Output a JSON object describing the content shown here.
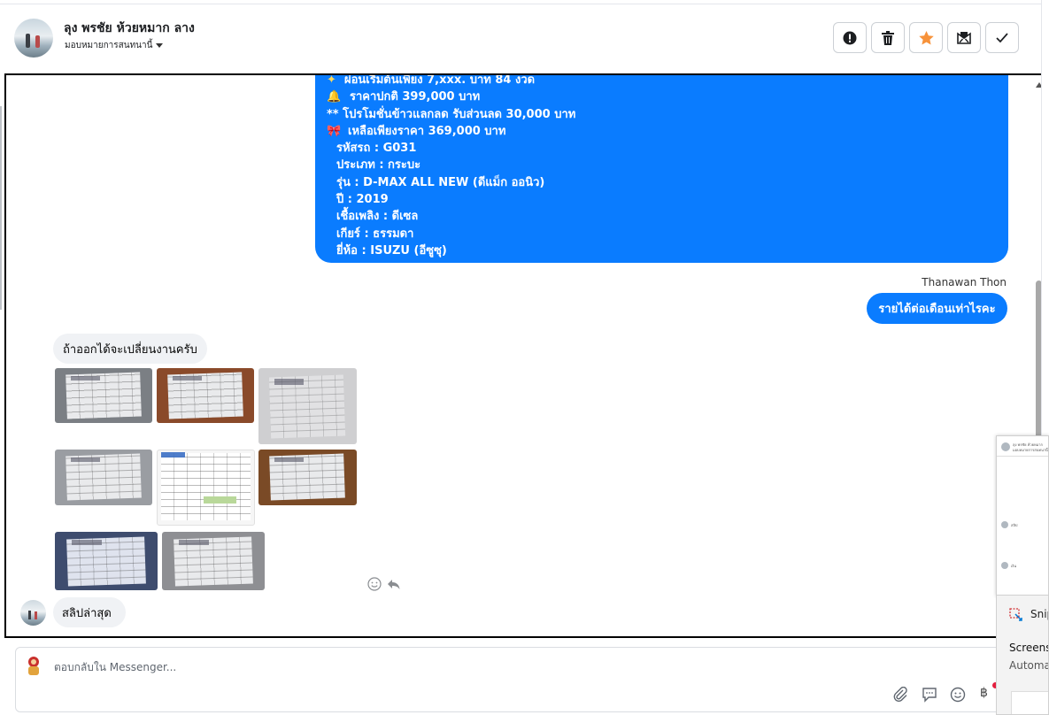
{
  "header": {
    "contact_name": "ลุง พรชัย ห้วยหมาก ลาง",
    "assign_label": "มอบหมายการสนทนานี้",
    "actions": [
      {
        "name": "spam-button",
        "icon": "exclamation-icon"
      },
      {
        "name": "delete-button",
        "icon": "trash-icon"
      },
      {
        "name": "star-button",
        "icon": "star-icon",
        "color": "#f7923a"
      },
      {
        "name": "archive-button",
        "icon": "envelope-x-icon"
      },
      {
        "name": "done-button",
        "icon": "checkmark-icon"
      }
    ]
  },
  "conversation": {
    "outgoing_offer": {
      "lines": [
        "ผ่อนเริ่มต้นเพียง 7,xxx. บาท 84 งวด",
        "ราคาปกติ 399,000 บาท",
        "** โปรโมชั่นข้าวแลกลด รับส่วนลด 30,000 บาท",
        "เหลือเพียงราคา 369,000 บาท",
        "รหัสรถ : G031",
        "ประเภท : กระบะ",
        "รุ่น : D-MAX ALL NEW (ดีแม็ก ออนิว)",
        "ปี : 2019",
        "เชื้อเพลิง : ดีเซล",
        "เกียร์ : ธรรมดา",
        "ยี่ห้อ : ISUZU (อีซูซุ)"
      ]
    },
    "sender_name": "Thanawan Thon",
    "outgoing_question": "รายได้ต่อเดือนเท่าไรคะ",
    "incoming_reply": "ถ้าออกได้จะเปลี่ยนงานครับ",
    "photo_count": 8,
    "incoming_last": "สลิปล่าสุด"
  },
  "composer": {
    "placeholder": "ตอบกลับใน Messenger...",
    "currency_symbol": "฿"
  },
  "snip_notification": {
    "app_name": "Snip",
    "title": "Screens",
    "subtitle": "Automa",
    "thumb_texts": [
      "ลุง พรชัย ห้วยหมาก",
      "มอบหมายการสนทนานี้",
      "สลิป",
      "เงิน"
    ]
  }
}
